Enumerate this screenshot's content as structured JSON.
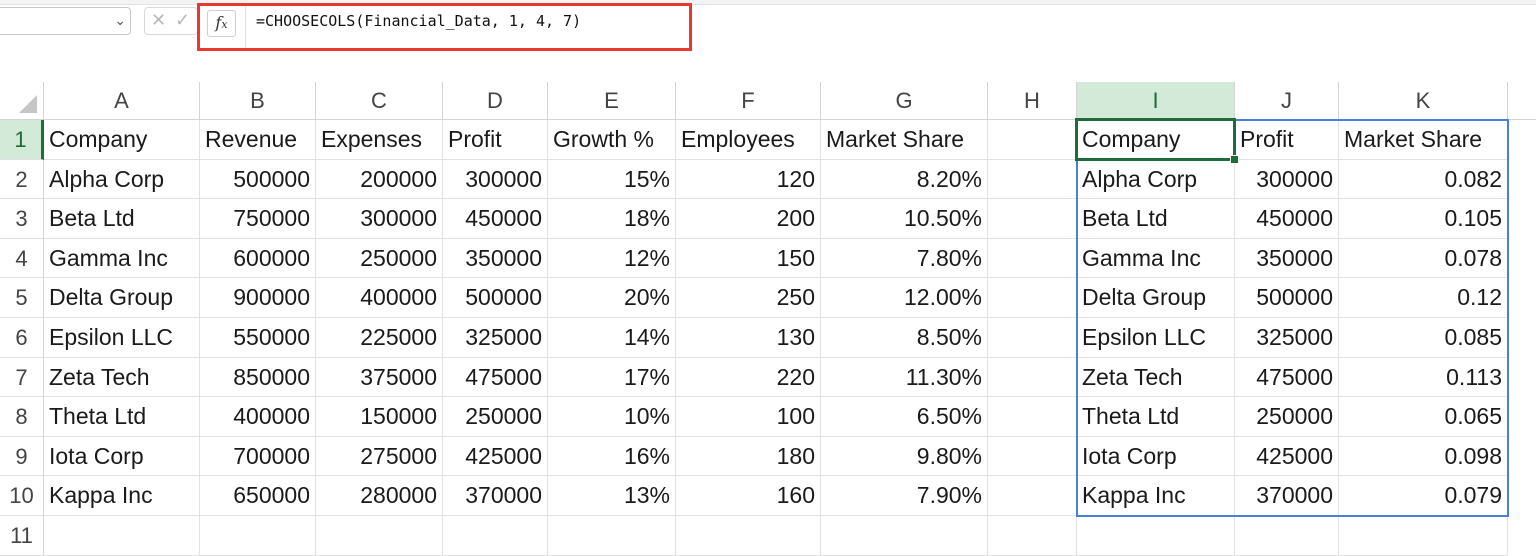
{
  "formula_bar": {
    "name_box": "",
    "fx_label": "fx",
    "formula": "=CHOOSECOLS(Financial_Data, 1, 4, 7)"
  },
  "columns": [
    "A",
    "B",
    "C",
    "D",
    "E",
    "F",
    "G",
    "H",
    "I",
    "J",
    "K"
  ],
  "selected_column": "I",
  "selected_row": "1",
  "rows": [
    "1",
    "2",
    "3",
    "4",
    "5",
    "6",
    "7",
    "8",
    "9",
    "10",
    "11"
  ],
  "source_table": {
    "headers": [
      "Company",
      "Revenue",
      "Expenses",
      "Profit",
      "Growth %",
      "Employees",
      "Market Share"
    ],
    "rows": [
      [
        "Alpha Corp",
        "500000",
        "200000",
        "300000",
        "15%",
        "120",
        "8.20%"
      ],
      [
        "Beta Ltd",
        "750000",
        "300000",
        "450000",
        "18%",
        "200",
        "10.50%"
      ],
      [
        "Gamma Inc",
        "600000",
        "250000",
        "350000",
        "12%",
        "150",
        "7.80%"
      ],
      [
        "Delta Group",
        "900000",
        "400000",
        "500000",
        "20%",
        "250",
        "12.00%"
      ],
      [
        "Epsilon LLC",
        "550000",
        "225000",
        "325000",
        "14%",
        "130",
        "8.50%"
      ],
      [
        "Zeta Tech",
        "850000",
        "375000",
        "475000",
        "17%",
        "220",
        "11.30%"
      ],
      [
        "Theta Ltd",
        "400000",
        "150000",
        "250000",
        "10%",
        "100",
        "6.50%"
      ],
      [
        "Iota Corp",
        "700000",
        "275000",
        "425000",
        "16%",
        "180",
        "9.80%"
      ],
      [
        "Kappa Inc",
        "650000",
        "280000",
        "370000",
        "13%",
        "160",
        "7.90%"
      ]
    ]
  },
  "result_table": {
    "headers": [
      "Company",
      "Profit",
      "Market Share"
    ],
    "rows": [
      [
        "Alpha Corp",
        "300000",
        "0.082"
      ],
      [
        "Beta Ltd",
        "450000",
        "0.105"
      ],
      [
        "Gamma Inc",
        "350000",
        "0.078"
      ],
      [
        "Delta Group",
        "500000",
        "0.12"
      ],
      [
        "Epsilon LLC",
        "325000",
        "0.085"
      ],
      [
        "Zeta Tech",
        "475000",
        "0.113"
      ],
      [
        "Theta Ltd",
        "250000",
        "0.065"
      ],
      [
        "Iota Corp",
        "425000",
        "0.098"
      ],
      [
        "Kappa Inc",
        "370000",
        "0.079"
      ]
    ]
  },
  "colors": {
    "selection_green": "#1e6b3c",
    "spill_border_blue": "#4a7fd6",
    "formula_highlight_red": "#e8392e"
  }
}
